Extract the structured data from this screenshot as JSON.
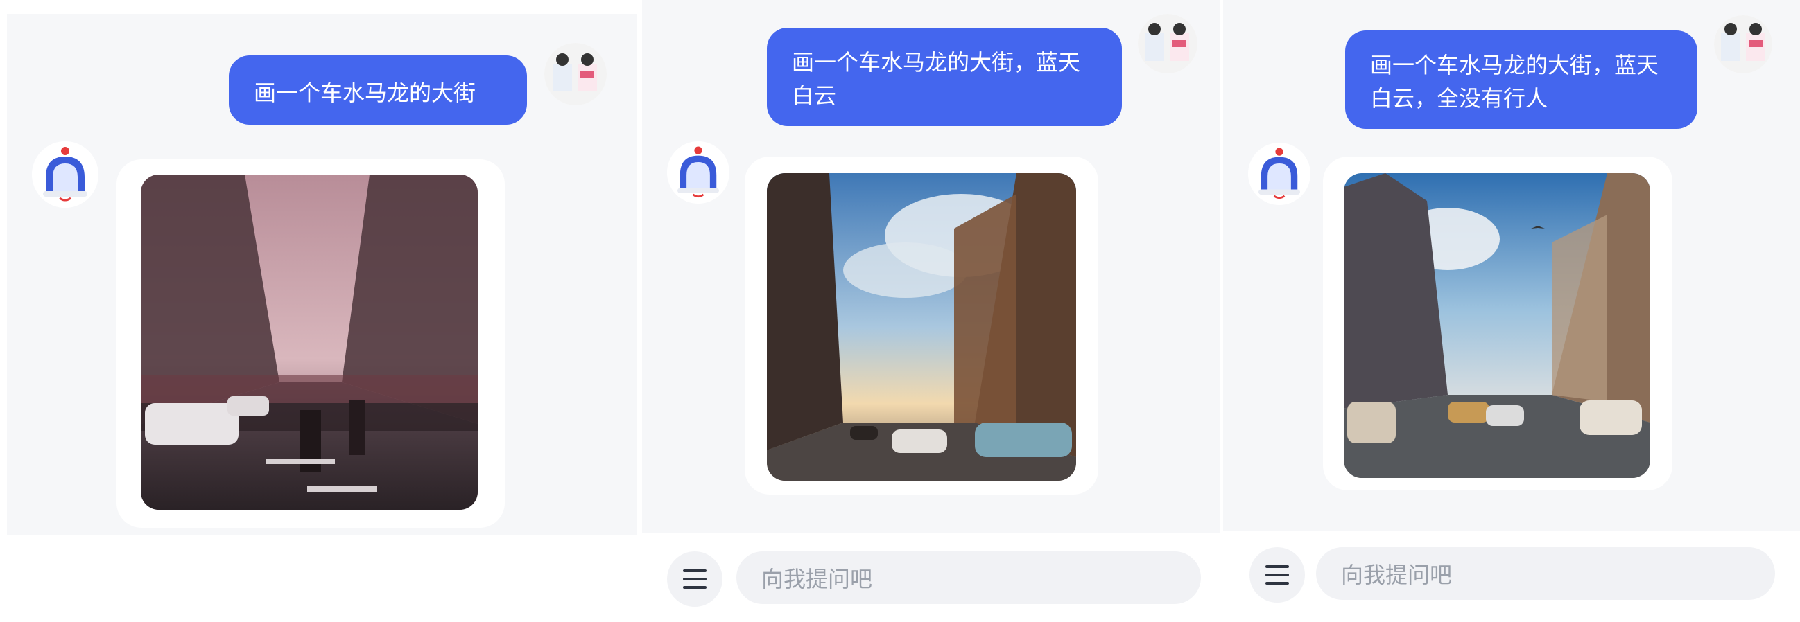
{
  "colors": {
    "accent": "#4466ee",
    "chat_background": "#f6f7f9",
    "input_background": "#f1f2f5",
    "placeholder_text": "#9aa0aa"
  },
  "icons": {
    "bot_avatar": "bell-robot-icon",
    "user_avatar": "user-photo-avatar",
    "menu": "hamburger-menu-icon"
  },
  "panels": [
    {
      "user_message": "画一个车水马龙的大街",
      "generated_image": "crowded-street-foggy-pink-sky"
    },
    {
      "user_message": "画一个车水马龙的大街，蓝天\n白云",
      "generated_image": "street-with-cars-blue-sky-clouds",
      "input": {
        "placeholder": "向我提问吧"
      }
    },
    {
      "user_message": "画一个车水马龙的大街，蓝天\n白云，全没有行人",
      "generated_image": "street-with-cars-blue-sky-no-pedestrians",
      "input": {
        "placeholder": "向我提问吧"
      }
    }
  ]
}
